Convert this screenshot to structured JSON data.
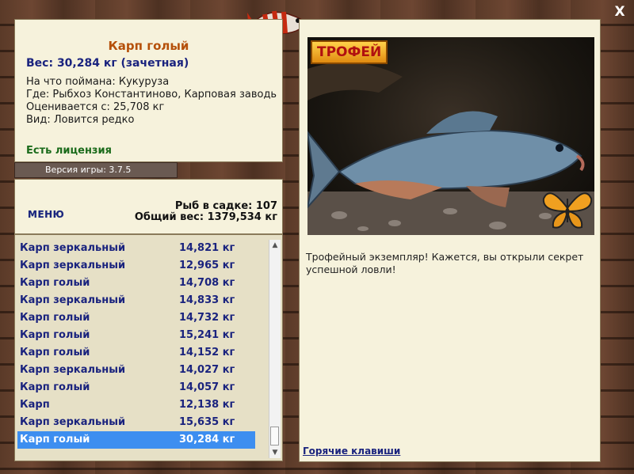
{
  "selected_fish": {
    "title": "Карп голый",
    "weight": "Вес: 30,284 кг (зачетная)",
    "bait": "На что поймана: Кукуруза",
    "place": "Где: Рыбхоз Константиново, Карповая заводь",
    "valued": "Оценивается с: 25,708 кг",
    "species": "Вид: Ловится редко",
    "license": "Есть лицензия"
  },
  "version": "Версия игры: 3.7.5",
  "menu_label": "МЕНЮ",
  "stats": {
    "count": "Рыб в садке: 107",
    "total_weight": "Общий вес: 1379,534 кг"
  },
  "catch_list": [
    {
      "name": "Карп зеркальный",
      "weight": "14,821 кг"
    },
    {
      "name": "Карп зеркальный",
      "weight": "12,965 кг"
    },
    {
      "name": "Карп голый",
      "weight": "14,708 кг"
    },
    {
      "name": "Карп зеркальный",
      "weight": "14,833 кг"
    },
    {
      "name": "Карп голый",
      "weight": "14,732 кг"
    },
    {
      "name": "Карп голый",
      "weight": "15,241 кг"
    },
    {
      "name": "Карп голый",
      "weight": "14,152 кг"
    },
    {
      "name": "Карп зеркальный",
      "weight": "14,027 кг"
    },
    {
      "name": "Карп голый",
      "weight": "14,057 кг"
    },
    {
      "name": "Карп",
      "weight": "12,138 кг"
    },
    {
      "name": "Карп зеркальный",
      "weight": "15,635 кг"
    },
    {
      "name": "Карп голый",
      "weight": "30,284 кг"
    }
  ],
  "trophy": {
    "badge": "ТРОФЕЙ",
    "text": "Трофейный экземпляр! Кажется, вы открыли секрет успешной ловли!",
    "hotkeys": "Горячие клавиши"
  },
  "close_label": "X",
  "colors": {
    "selected_row": "#3d8ef0",
    "title": "#b5500a",
    "link": "#1a237e",
    "license": "#1b6b1b"
  }
}
